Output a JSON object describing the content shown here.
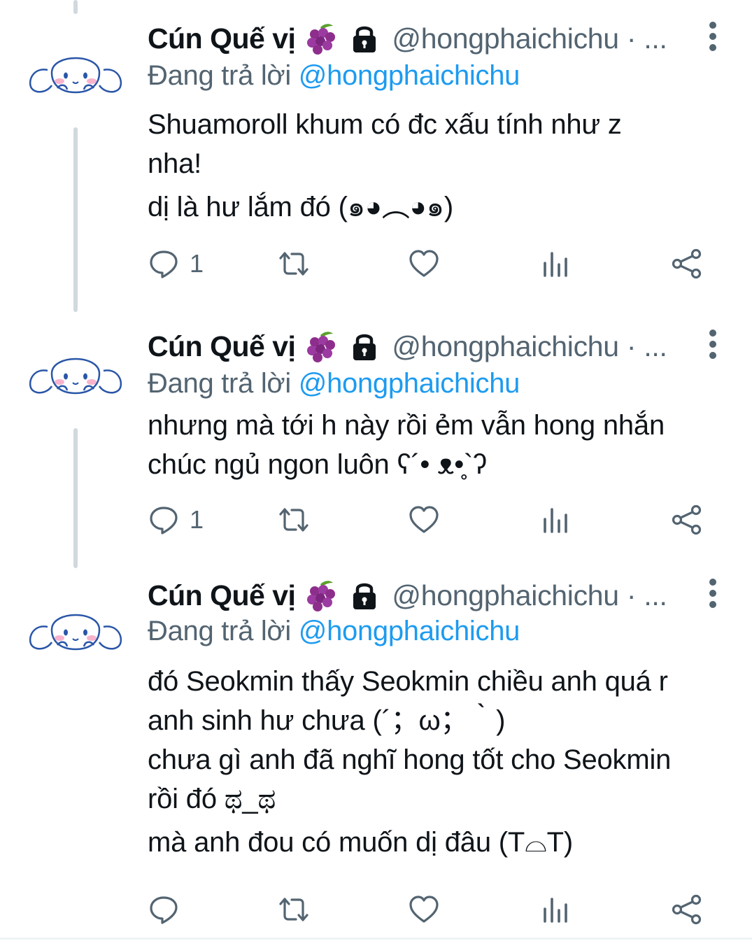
{
  "colors": {
    "accent": "#1d9bf0",
    "secondary_text": "#536471",
    "primary_text": "#0f1419",
    "thread_line": "#cfd9de"
  },
  "tweets": [
    {
      "display_name": "Cún Quế vị",
      "badges": [
        "grapes-emoji",
        "lock-icon"
      ],
      "handle": "@hongphaichichu · ...",
      "replying_prefix": "Đang trả lời",
      "replying_to": "@hongphaichichu",
      "lines": [
        "Shuamoroll khum có đc xấu tính như z",
        "nha!",
        "dị là hư lắm đó (๑◕︵◕๑)"
      ],
      "actions": {
        "reply_count": "1",
        "retweet_count": "",
        "like_count": ""
      }
    },
    {
      "display_name": "Cún Quế vị",
      "badges": [
        "grapes-emoji",
        "lock-icon"
      ],
      "handle": "@hongphaichichu · ...",
      "replying_prefix": "Đang trả lời",
      "replying_to": "@hongphaichichu",
      "lines": [
        "nhưng mà tới h này rồi ẻm vẫn hong nhắn",
        "chúc ngủ ngon luôn ʕ´• ᴥ•̥`ʔ"
      ],
      "actions": {
        "reply_count": "1",
        "retweet_count": "",
        "like_count": ""
      }
    },
    {
      "display_name": "Cún Quế vị",
      "badges": [
        "grapes-emoji",
        "lock-icon"
      ],
      "handle": "@hongphaichichu · ...",
      "replying_prefix": "Đang trả lời",
      "replying_to": "@hongphaichichu",
      "lines": [
        "đó Seokmin thấy Seokmin chiều anh quá r",
        "anh sinh hư chưa (´；ω；｀)",
        "chưa gì anh đã nghĩ hong tốt cho Seokmin",
        "rồi đó ಥ_ಥ",
        "mà anh đou có muốn dị đâu (T⌓T)"
      ],
      "actions": {
        "reply_count": "",
        "retweet_count": "",
        "like_count": ""
      }
    }
  ]
}
